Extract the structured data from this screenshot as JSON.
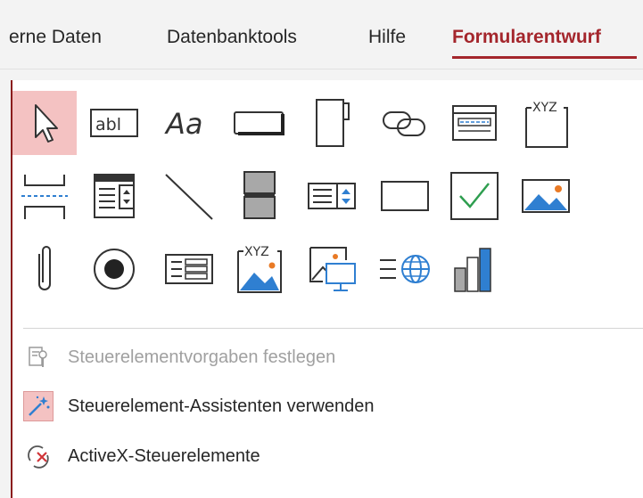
{
  "tabs": [
    {
      "label": "erne Daten"
    },
    {
      "label": "Datenbanktools"
    },
    {
      "label": "Hilfe"
    },
    {
      "label": "Formularentwurf",
      "active": true
    }
  ],
  "tool_icons": {
    "label_text": "abl",
    "font_text": "Aa",
    "xyz_text": "XYZ"
  },
  "tools": [
    [
      "select-pointer-icon",
      "textbox-icon",
      "label-icon",
      "button-icon",
      "tab-control-icon",
      "hyperlink-icon",
      "web-browser-icon",
      "navigation-control-icon"
    ],
    [
      "page-break-icon",
      "combo-box-icon",
      "line-icon",
      "toggle-button-icon",
      "list-box-icon",
      "rectangle-icon",
      "checkbox-icon",
      "image-icon"
    ],
    [
      "attachment-icon",
      "option-button-icon",
      "subform-icon",
      "bound-object-frame-icon",
      "image-control-icon",
      "insert-web-icon",
      "chart-icon"
    ]
  ],
  "menu": {
    "defaults": {
      "label": "Steuerelementvorgaben festlegen",
      "enabled": false
    },
    "wizards": {
      "label": "Steuerelement-Assistenten verwenden",
      "enabled": true
    },
    "activex": {
      "label": "ActiveX-Steuerelemente",
      "enabled": true
    }
  },
  "colors": {
    "accent": "#a4262c",
    "selected_bg": "#f4c2c2",
    "icon_blue": "#2f7fd1",
    "icon_green": "#2e9e4f"
  }
}
